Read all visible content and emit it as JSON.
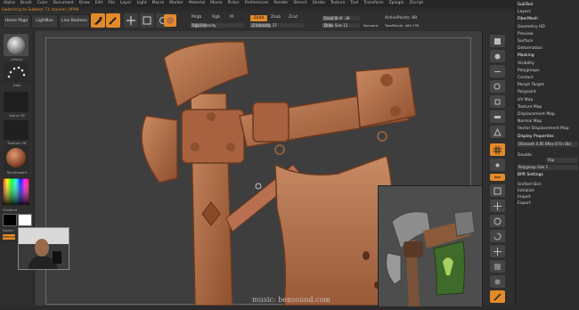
{
  "menubar": [
    "Alpha",
    "Brush",
    "Color",
    "Document",
    "Draw",
    "Edit",
    "File",
    "Layer",
    "Light",
    "Macro",
    "Marker",
    "Material",
    "Movie",
    "Picker",
    "Preferences",
    "Render",
    "Stencil",
    "Stroke",
    "Texture",
    "Tool",
    "Transform",
    "Zplugin",
    "Zscript"
  ],
  "notice": "Switching to Subtool 73: banner_HP08",
  "toolbar": {
    "home_page": "Home Page",
    "lightbox": "LightBox",
    "live_boolean": "Live Boolean",
    "tools": [
      {
        "label": "Edit",
        "icon": "edit-icon",
        "active": true
      },
      {
        "label": "Draw",
        "icon": "draw-icon",
        "active": true
      },
      {
        "label": "Move",
        "icon": "move-icon",
        "active": false
      },
      {
        "label": "Scale",
        "icon": "scale-icon",
        "active": false
      },
      {
        "label": "Rotate",
        "icon": "rotate-icon",
        "active": false
      }
    ],
    "mrgb": "Mrgb",
    "rgb": "Rgb",
    "m": "M",
    "zadd": "Zadd",
    "zsub": "Zsub",
    "zcut": "Zcut",
    "rgb_intensity": "Rgb Intensity",
    "z_intensity": "Z Intensity 37",
    "focal_shift": "Focal Shift -38",
    "draw_size": "Draw Size 12",
    "dynamic": "Dynamic",
    "active_points": "ActivePoints: 88",
    "total_points": "TotalPoints: 484.705"
  },
  "left": {
    "brush_label": "hPolish",
    "stroke_label": "Dots",
    "alpha_label": "Alpha Off",
    "texture_label": "Texture Off",
    "material_label": "SkinShade4",
    "gradient_label": "Gradient",
    "switch_label": "Switch",
    "alternate_label": "Alternate"
  },
  "right_panel": {
    "items": [
      "SubTool",
      "Layers",
      "FiberMesh",
      "Geometry HD",
      "Preview",
      "Surface",
      "Deformation",
      "Masking",
      "Visibility",
      "Polygroups",
      "Contact",
      "Morph Target",
      "Polypaint",
      "UV Map",
      "Texture Map",
      "Displacement Map",
      "Normal Map",
      "Vector Displacement Map",
      "Display Properties"
    ],
    "display_props": "DSmooth 0.85   BRes  B  Fin  Dbl",
    "double": "Double",
    "flip": "Flip",
    "polygroup_size": "Polygroup Size 1",
    "bpr_settings": "BPR Settings",
    "unified_skin": "Unified Skin",
    "initialize": "Initialize",
    "import": "Import",
    "export": "Export"
  },
  "watermark": "music: bensound.com",
  "colors": {
    "accent": "#e38a29",
    "wood": "#b8714a",
    "cloth": "#b97a55",
    "bg": "#3e3e3e"
  }
}
